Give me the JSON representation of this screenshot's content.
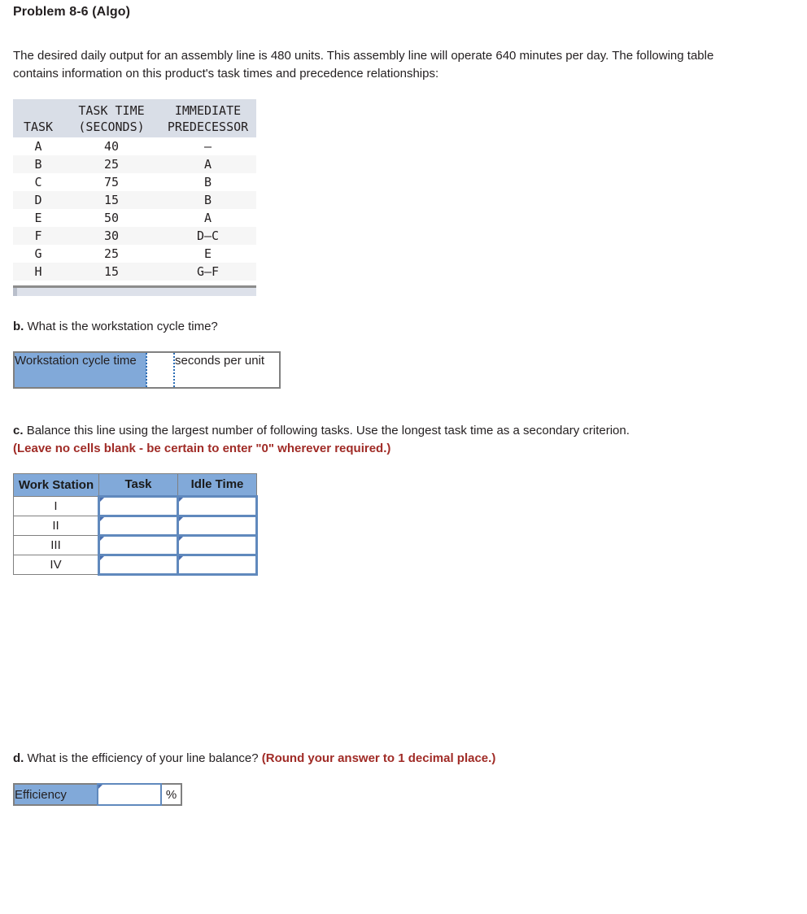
{
  "problem": {
    "title": "Problem 8-6 (Algo)",
    "intro": "The desired daily output for an assembly line is 480 units. This assembly line will operate 640 minutes per day. The following table contains information on this product's task times and precedence relationships:"
  },
  "task_table": {
    "headers": {
      "task": "TASK",
      "task_time": "TASK TIME\n(SECONDS)",
      "predecessor": "IMMEDIATE\nPREDECESSOR"
    },
    "rows": [
      {
        "task": "A",
        "time": "40",
        "predecessor": "—"
      },
      {
        "task": "B",
        "time": "25",
        "predecessor": "A"
      },
      {
        "task": "C",
        "time": "75",
        "predecessor": "B"
      },
      {
        "task": "D",
        "time": "15",
        "predecessor": "B"
      },
      {
        "task": "E",
        "time": "50",
        "predecessor": "A"
      },
      {
        "task": "F",
        "time": "30",
        "predecessor": "D—C"
      },
      {
        "task": "G",
        "time": "25",
        "predecessor": "E"
      },
      {
        "task": "H",
        "time": "15",
        "predecessor": "G—F"
      }
    ]
  },
  "question_b": {
    "label": "b.",
    "text": "What is the workstation cycle time?",
    "answer_label": "Workstation cycle time",
    "answer_value": "",
    "unit": "seconds per unit"
  },
  "question_c": {
    "label": "c.",
    "text": "Balance this line using the largest number of following tasks. Use the longest task time as a secondary criterion.",
    "note": "(Leave no cells blank - be certain to enter \"0\" wherever required.)",
    "headers": {
      "work_station": "Work Station",
      "task": "Task",
      "idle_time": "Idle Time"
    },
    "rows": [
      {
        "station": "I",
        "task": "",
        "idle_time": ""
      },
      {
        "station": "II",
        "task": "",
        "idle_time": ""
      },
      {
        "station": "III",
        "task": "",
        "idle_time": ""
      },
      {
        "station": "IV",
        "task": "",
        "idle_time": ""
      }
    ]
  },
  "question_d": {
    "label": "d.",
    "text": "What is the efficiency of your line balance?",
    "note": "(Round your answer to 1 decimal place.)",
    "answer_label": "Efficiency",
    "answer_value": "",
    "unit": "%"
  },
  "colors": {
    "header_blue": "#81a9d9",
    "table_header_grey": "#d9dee7",
    "note_red": "#a02b26",
    "input_border_blue": "#6089bd",
    "row_alt": "#f6f6f6"
  }
}
